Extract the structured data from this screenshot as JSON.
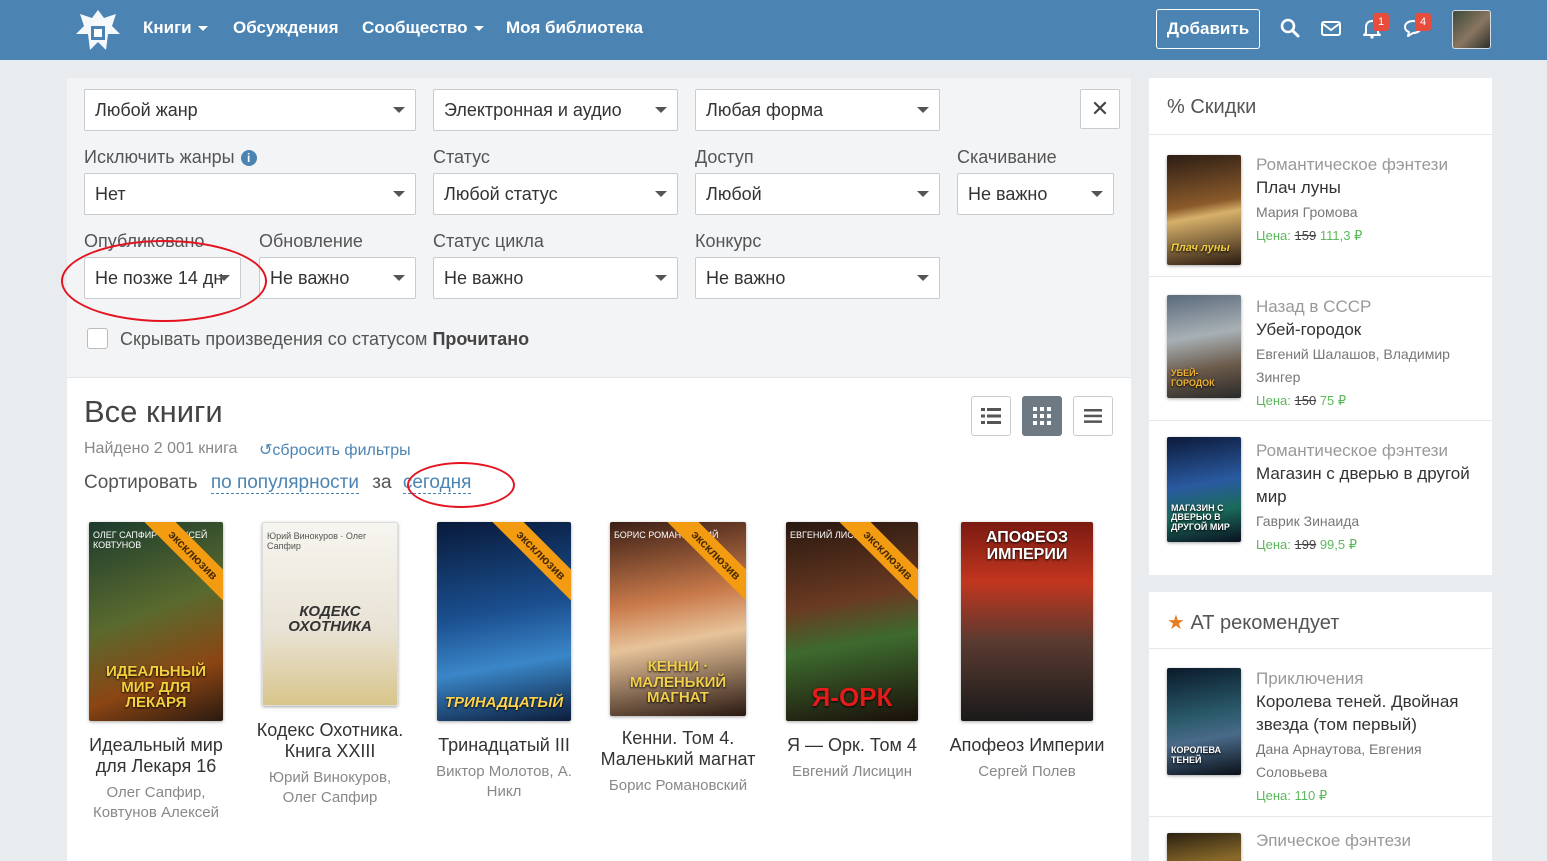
{
  "nav": {
    "books": "Книги",
    "discussions": "Обсуждения",
    "community": "Сообщество",
    "library": "Моя библиотека",
    "add_button": "Добавить",
    "notifications_count": "1",
    "messages_count": "4"
  },
  "filters": {
    "genre": "Любой жанр",
    "format": "Электронная и аудио",
    "form": "Любая форма",
    "exclude_genres_label": "Исключить жанры",
    "exclude_genres_value": "Нет",
    "status_label": "Статус",
    "status_value": "Любой статус",
    "access_label": "Доступ",
    "access_value": "Любой",
    "download_label": "Скачивание",
    "download_value": "Не важно",
    "published_label": "Опубликовано",
    "published_value": "Не позже 14 дн",
    "update_label": "Обновление",
    "update_value": "Не важно",
    "cycle_status_label": "Статус цикла",
    "cycle_status_value": "Не важно",
    "contest_label": "Конкурс",
    "contest_value": "Не важно",
    "hide_read_text": "Скрывать произведения со статусом",
    "hide_read_bold": "Прочитано"
  },
  "catalog": {
    "title": "Все книги",
    "found": "Найдено 2 001 книга",
    "reset": "сбросить фильтры",
    "sort_label": "Сортировать",
    "sort_by": "по популярности",
    "sort_for": "за",
    "sort_period": "сегодня"
  },
  "books": [
    {
      "title": "Идеальный мир для Лекаря 16",
      "author": "Олег Сапфир, Ковтунов Алексей",
      "cover_text": "ИДЕАЛЬНЫЙ МИР ДЛЯ ЛЕКАРЯ",
      "cover_top": "ОЛЕГ САПФИР · АЛЕКСЕЙ КОВТУНОВ",
      "exclusive": "эксклюзив"
    },
    {
      "title": "Кодекс Охотника. Книга XXIII",
      "author": "Юрий Винокуров, Олег Сапфир",
      "cover_text": "КОДЕКС ОХОТНИКА",
      "cover_top": "Юрий Винокуров · Олег Сапфир",
      "exclusive": ""
    },
    {
      "title": "Тринадцатый III",
      "author": "Виктор Молотов, А. Никл",
      "cover_text": "ТРИНАДЦАТЫЙ",
      "cover_top": "",
      "exclusive": "эксклюзив"
    },
    {
      "title": "Кенни. Том 4. Маленький магнат",
      "author": "Борис Романовский",
      "cover_text": "КЕННИ · МАЛЕНЬКИЙ МАГНАТ",
      "cover_top": "БОРИС РОМАНОВСКИЙ",
      "exclusive": "эксклюзив"
    },
    {
      "title": "Я — Орк. Том 4",
      "author": "Евгений Лисицин",
      "cover_text": "Я-ОРК",
      "cover_top": "ЕВГЕНИЙ ЛИСИЦИН",
      "exclusive": "эксклюзив"
    },
    {
      "title": "Апофеоз Империи",
      "author": "Сергей Полев",
      "cover_text": "АПОФЕОЗ ИМПЕРИИ",
      "cover_top": "",
      "exclusive": ""
    }
  ],
  "sidebar": {
    "discounts_title": "% Скидки",
    "price_label": "Цена:",
    "discounts": [
      {
        "genre": "Романтическое фэнтези",
        "title": "Плач луны",
        "author": "Мария Громова",
        "old_price": "159",
        "price": "111,3 ₽",
        "cover_text": "Плач луны"
      },
      {
        "genre": "Назад в СССР",
        "title": "Убей-городок",
        "author": "Евгений Шалашов, Владимир Зингер",
        "old_price": "150",
        "price": "75 ₽",
        "cover_text": "УБЕЙ-ГОРОДОК"
      },
      {
        "genre": "Романтическое фэнтези",
        "title": "Магазин с дверью в другой мир",
        "author": "Гаврик Зинаида",
        "old_price": "199",
        "price": "99,5 ₽",
        "cover_text": "МАГАЗИН С ДВЕРЬЮ В ДРУГОЙ МИР"
      }
    ],
    "recommends_title": "АТ рекомендует",
    "recommends": [
      {
        "genre": "Приключения",
        "title": "Королева теней. Двойная звезда (том первый)",
        "author": "Дана Арнаутова, Евгения Соловьева",
        "price": "110 ₽",
        "cover_text": "КОРОЛЕВА ТЕНЕЙ"
      },
      {
        "genre": "Эпическое фэнтези"
      }
    ]
  },
  "colors": {
    "brand": "#4b84b3",
    "accent_badge": "#e74c3c",
    "ribbon": "#f39c12",
    "price": "#5cb85c",
    "annotation": "#e3141f"
  }
}
